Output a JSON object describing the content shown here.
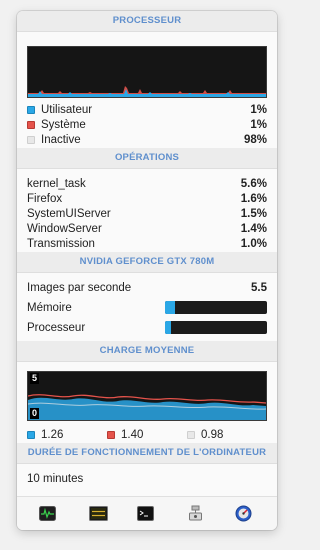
{
  "cpu": {
    "header": "PROCESSEUR",
    "legend": [
      {
        "label": "Utilisateur",
        "value": "1%",
        "color": "#2aa7e6"
      },
      {
        "label": "Système",
        "value": "1%",
        "color": "#e5534b"
      },
      {
        "label": "Inactive",
        "value": "98%",
        "color": "#e8e8e8"
      }
    ]
  },
  "operations": {
    "header": "OPÉRATIONS",
    "processes": [
      {
        "name": "kernel_task",
        "value": "5.6%"
      },
      {
        "name": "Firefox",
        "value": "1.6%"
      },
      {
        "name": "SystemUIServer",
        "value": "1.5%"
      },
      {
        "name": "WindowServer",
        "value": "1.4%"
      },
      {
        "name": "Transmission",
        "value": "1.0%"
      }
    ]
  },
  "gpu": {
    "header": "NVIDIA GEFORCE GTX 780M",
    "fps_label": "Images par seconde",
    "fps_value": "5.5",
    "memory_label": "Mémoire",
    "memory_fraction": 0.1,
    "processor_label": "Processeur",
    "processor_fraction": 0.06
  },
  "load": {
    "header": "CHARGE MOYENNE",
    "scale_max": "5",
    "scale_min": "0",
    "values": [
      {
        "label": "1.26",
        "color": "#2aa7e6"
      },
      {
        "label": "1.40",
        "color": "#e5534b"
      },
      {
        "label": "0.98",
        "color": "#e8e8e8"
      }
    ]
  },
  "uptime": {
    "header": "DURÉE DE FONCTIONNEMENT DE L'ORDINATEUR",
    "value": "10 minutes"
  },
  "toolbar": {
    "icons": [
      "activity-monitor-icon",
      "console-icon",
      "terminal-icon",
      "system-info-icon",
      "disk-utility-icon"
    ],
    "console_icon_text": "WARNING\nAY 7:36"
  },
  "colors": {
    "accent": "#5f8fcd",
    "user": "#2aa7e6",
    "system": "#e5534b",
    "graph_bg": "#151515"
  }
}
